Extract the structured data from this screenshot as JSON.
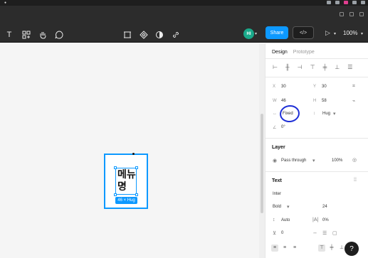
{
  "toolbar": {
    "avatar_initials": "HI",
    "share_label": "Share",
    "dev_label": "</>",
    "zoom_label": "100%"
  },
  "canvas": {
    "text_content": "메뉴\n명",
    "size_badge": "46 × Hug"
  },
  "panel": {
    "tab_design": "Design",
    "tab_prototype": "Prototype",
    "x_label": "X",
    "x_value": "30",
    "y_label": "Y",
    "y_value": "30",
    "w_label": "W",
    "w_value": "46",
    "h_label": "H",
    "h_value": "58",
    "width_mode": "Fixed",
    "height_mode": "Hug",
    "rotation_value": "0°",
    "layer_title": "Layer",
    "blend_mode": "Pass through",
    "opacity": "100%",
    "text_title": "Text",
    "font_family": "Inter",
    "font_weight": "Bold",
    "font_size": "24",
    "line_height": "Auto",
    "letter_spacing": "0%",
    "paragraph_spacing": "0"
  },
  "colors": {
    "accent": "#0d99ff",
    "annotation": "#1e2fd6",
    "toolbar_bg": "#2c2c2c"
  }
}
